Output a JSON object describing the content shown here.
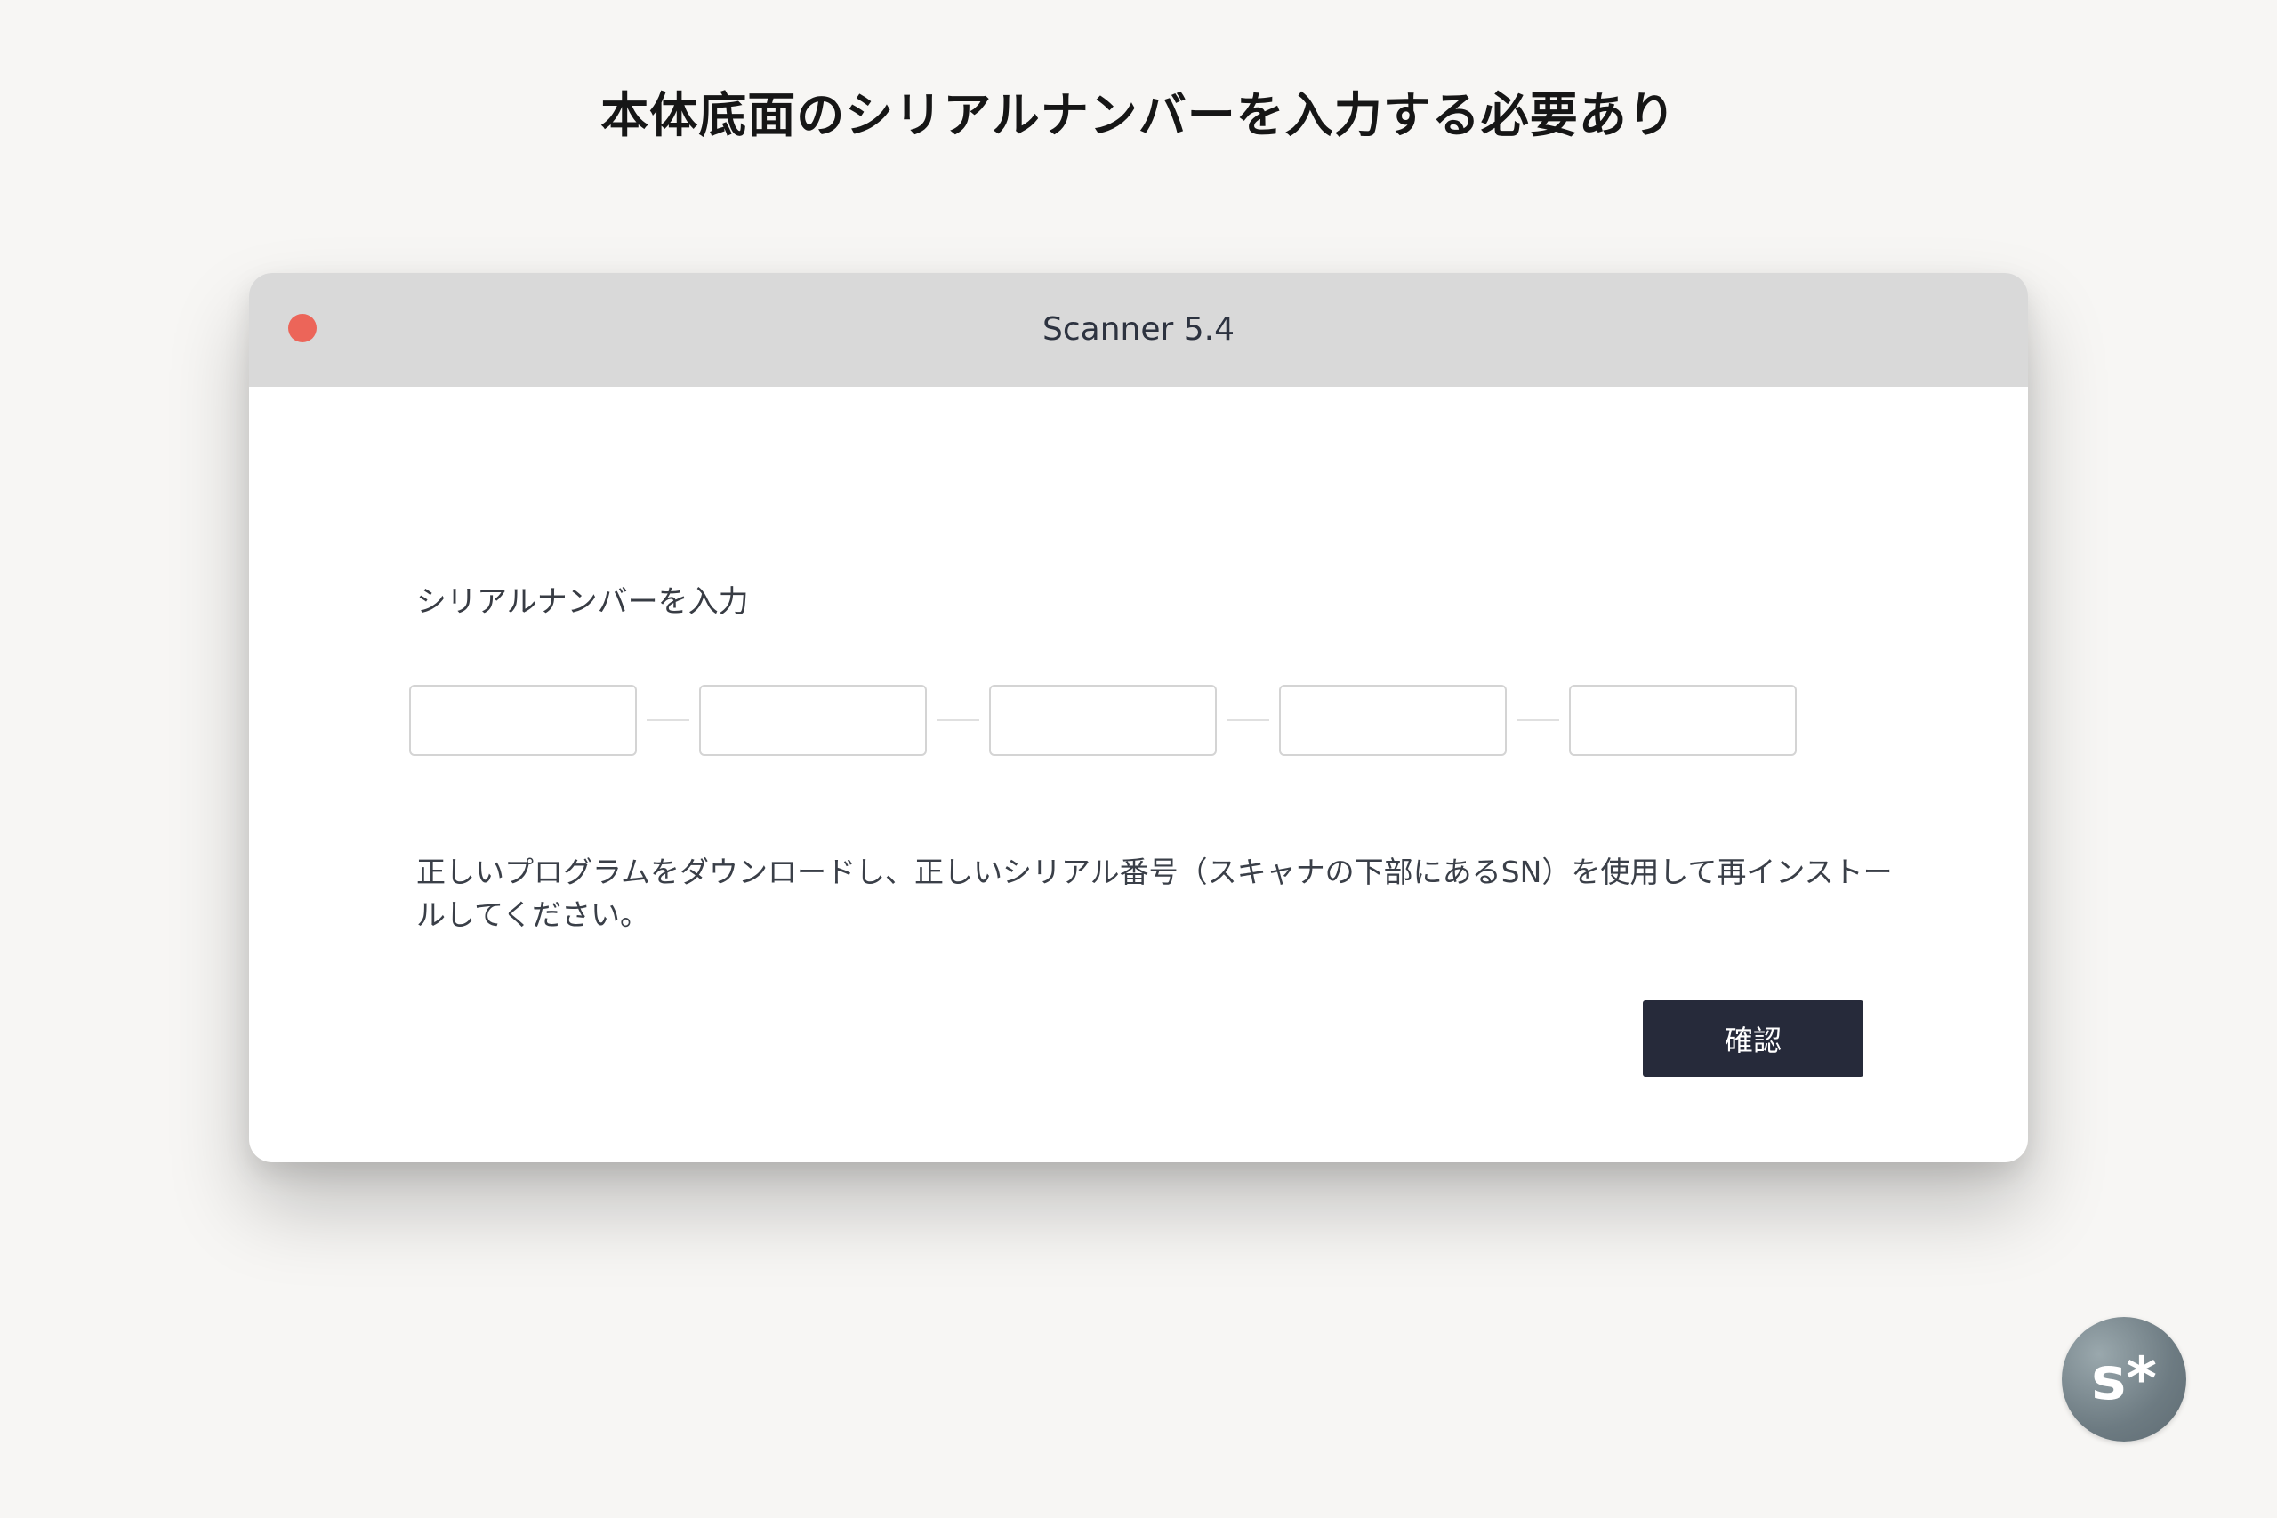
{
  "caption": "本体底面のシリアルナンバーを入力する必要あり",
  "window": {
    "title": "Scanner 5.4",
    "close_color": "#ec6559"
  },
  "form": {
    "label": "シリアルナンバーを入力",
    "serial_fields": [
      {
        "value": ""
      },
      {
        "value": ""
      },
      {
        "value": ""
      },
      {
        "value": ""
      },
      {
        "value": ""
      }
    ],
    "help_text": "正しいプログラムをダウンロードし、正しいシリアル番号（スキャナの下部にあるSN）を使用して再インストールしてください。",
    "confirm_label": "確認"
  },
  "logo": {
    "text": "s*",
    "icon": "brand-logo-icon"
  },
  "colors": {
    "page_background": "#f7f6f4",
    "titlebar": "#d9d9d9",
    "button": "#262a3a"
  }
}
